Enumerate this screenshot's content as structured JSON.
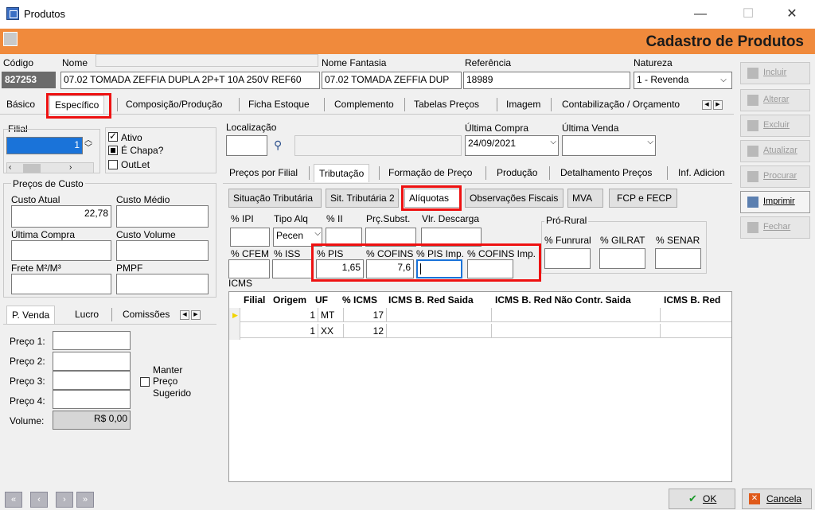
{
  "window": {
    "title": "Produtos",
    "minimize": "—",
    "maximize": "☐",
    "close": "✕"
  },
  "banner": {
    "title": "Cadastro de Produtos"
  },
  "header": {
    "codigo_label": "Código",
    "codigo_value": "827253",
    "nome_label": "Nome",
    "nome_value": "07.02 TOMADA ZEFFIA DUPLA 2P+T 10A 250V REF60",
    "fantasia_label": "Nome Fantasia",
    "fantasia_value": "07.02 TOMADA ZEFFIA DUP",
    "referencia_label": "Referência",
    "referencia_value": "18989",
    "natureza_label": "Natureza",
    "natureza_value": "1 - Revenda"
  },
  "main_tabs": [
    "Básico",
    "Específico",
    "Composição/Produção",
    "Ficha Estoque",
    "Complemento",
    "Tabelas Preços",
    "Imagem",
    "Contabilização / Orçamento"
  ],
  "left": {
    "filial_label": "Filial",
    "filial_value": "1",
    "ativo": "Ativo",
    "chapa": "É Chapa?",
    "outlet": "OutLet",
    "precos_custo": "Preços de Custo",
    "custo_atual_label": "Custo Atual",
    "custo_atual_value": "22,78",
    "custo_medio_label": "Custo Médio",
    "ultima_compra_label": "Última Compra",
    "custo_volume_label": "Custo Volume",
    "frete_label": "Frete M²/M³",
    "pmpf_label": "PMPF"
  },
  "venda_tabs": [
    "P. Venda",
    "Lucro",
    "Comissões"
  ],
  "venda": {
    "preco1": "Preço 1:",
    "preco2": "Preço 2:",
    "preco3": "Preço 3:",
    "preco4": "Preço 4:",
    "volume_label": "Volume:",
    "volume_value": "R$ 0,00",
    "manter": "Manter",
    "manter2": "Preço",
    "manter3": "Sugerido"
  },
  "loc": {
    "localizacao_label": "Localização",
    "ultima_compra_label": "Última Compra",
    "ultima_compra_value": "24/09/2021",
    "ultima_venda_label": "Última Venda"
  },
  "sub_tabs": [
    "Preços por Filial",
    "Tributação",
    "Formação de Preço",
    "Produção",
    "Detalhamento Preços",
    "Inf. Adicion"
  ],
  "trib_buttons": [
    "Situação Tributária",
    "Sit. Tributária 2",
    "Alíquotas",
    "Observações Fiscais",
    "MVA",
    "FCP e FECP"
  ],
  "aliquotas": {
    "ipi": "% IPI",
    "tipo_alq": "Tipo Alq",
    "tipo_alq_value": "Pecen",
    "ii": "% II",
    "prc_subst": "Prç.Subst.",
    "vlr_descarga": "Vlr. Descarga",
    "cfem": "% CFEM",
    "iss": "% ISS",
    "pis": "% PIS",
    "pis_value": "1,65",
    "cofins": "% COFINS",
    "cofins_value": "7,6",
    "pis_imp": "% PIS Imp.",
    "cofins_imp": "% COFINS Imp.",
    "pro_rural": "Pró-Rural",
    "funrural": "% Funrural",
    "gilrat": "% GILRAT",
    "senar": "% SENAR",
    "icms": "ICMS"
  },
  "icms_grid": {
    "columns": [
      "Filial",
      "Origem",
      "UF",
      "% ICMS",
      "ICMS B. Red Saida",
      "ICMS B. Red Não Contr. Saida",
      "ICMS B. Red"
    ],
    "rows": [
      [
        "",
        "1",
        "MT",
        "17",
        "",
        "",
        ""
      ],
      [
        "",
        "1",
        "XX",
        "12",
        "",
        "",
        ""
      ]
    ]
  },
  "side_buttons": [
    "Incluir",
    "Alterar",
    "Excluir",
    "Atualizar",
    "Procurar",
    "Imprimir",
    "Fechar"
  ],
  "footer": {
    "ok": "OK",
    "cancel": "Cancela"
  }
}
